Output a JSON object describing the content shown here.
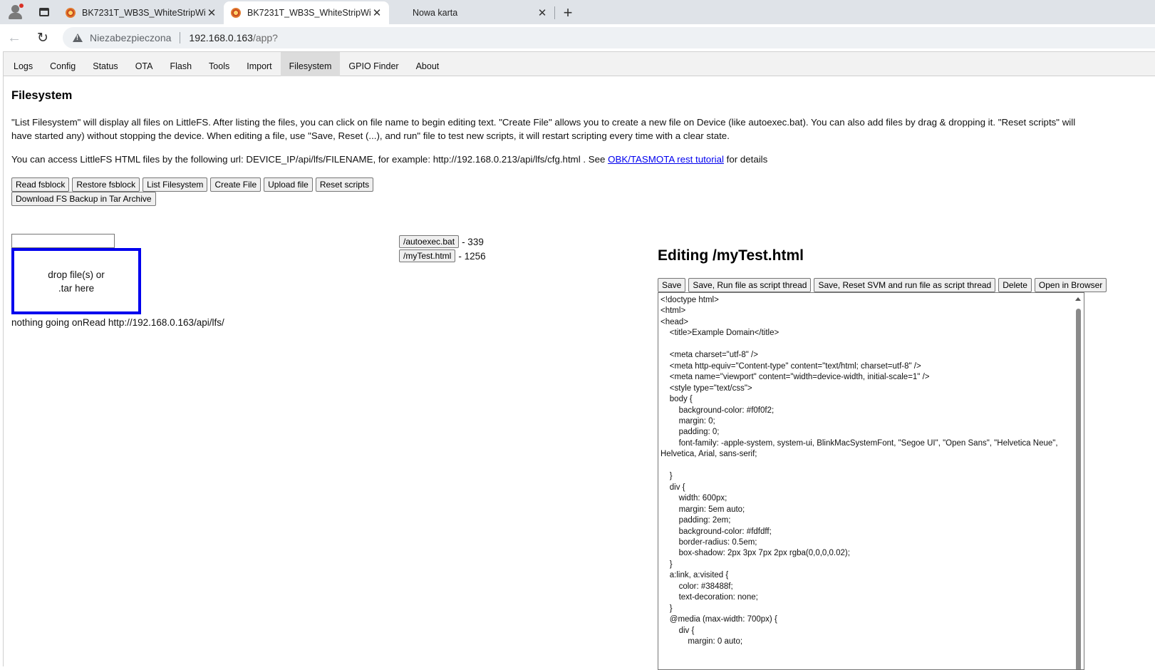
{
  "browser": {
    "tabs": [
      {
        "title": "BK7231T_WB3S_WhiteStripWindo",
        "active": false
      },
      {
        "title": "BK7231T_WB3S_WhiteStripWindo",
        "active": true
      },
      {
        "title": "Nowa karta",
        "active": false
      }
    ],
    "security_label": "Niezabezpieczona",
    "url_host": "192.168.0.163",
    "url_path": "/app?"
  },
  "nav": {
    "items": [
      "Logs",
      "Config",
      "Status",
      "OTA",
      "Flash",
      "Tools",
      "Import",
      "Filesystem",
      "GPIO Finder",
      "About"
    ],
    "active": "Filesystem"
  },
  "page": {
    "title": "Filesystem",
    "description_line1": "\"List Filesystem\" will display all files on LittleFS. After listing the files, you can click on file name to begin editing text. \"Create File\" allows you to create a new file on Device (like autoexec.bat). You can also add files by drag & dropping it. \"Reset scripts\" will",
    "description_line2": "have started any) without stopping the device. When editing a file, use \"Save, Reset (...), and run\" file to test new scripts, it will restart scripting every time with a clear state.",
    "access_prefix": "You can access LittleFS HTML files by the following url: DEVICE_IP/api/lfs/FILENAME, for example: http://192.168.0.213/api/lfs/cfg.html . See ",
    "access_link": "OBK/TASMOTA rest tutorial",
    "access_suffix": " for details",
    "buttons_row1": [
      "Read fsblock",
      "Restore fsblock",
      "List Filesystem",
      "Create File",
      "Upload file",
      "Reset scripts"
    ],
    "buttons_row2": [
      "Download FS Backup in Tar Archive"
    ],
    "new_file_input": "",
    "dropzone_line1": "drop file(s) or",
    "dropzone_line2": ".tar here",
    "status_text": "nothing going onRead http://192.168.0.163/api/lfs/",
    "files": [
      {
        "name": "/autoexec.bat",
        "size": "- 339"
      },
      {
        "name": "/myTest.html",
        "size": "- 1256"
      }
    ]
  },
  "editor": {
    "title": "Editing /myTest.html",
    "buttons": [
      "Save",
      "Save, Run file as script thread",
      "Save, Reset SVM and run file as script thread",
      "Delete",
      "Open in Browser"
    ],
    "content": "<!doctype html>\n<html>\n<head>\n    <title>Example Domain</title>\n\n    <meta charset=\"utf-8\" />\n    <meta http-equiv=\"Content-type\" content=\"text/html; charset=utf-8\" />\n    <meta name=\"viewport\" content=\"width=device-width, initial-scale=1\" />\n    <style type=\"text/css\">\n    body {\n        background-color: #f0f0f2;\n        margin: 0;\n        padding: 0;\n        font-family: -apple-system, system-ui, BlinkMacSystemFont, \"Segoe UI\", \"Open Sans\", \"Helvetica Neue\", Helvetica, Arial, sans-serif;\n\n    }\n    div {\n        width: 600px;\n        margin: 5em auto;\n        padding: 2em;\n        background-color: #fdfdff;\n        border-radius: 0.5em;\n        box-shadow: 2px 3px 7px 2px rgba(0,0,0,0.02);\n    }\n    a:link, a:visited {\n        color: #38488f;\n        text-decoration: none;\n    }\n    @media (max-width: 700px) {\n        div {\n            margin: 0 auto;"
  }
}
